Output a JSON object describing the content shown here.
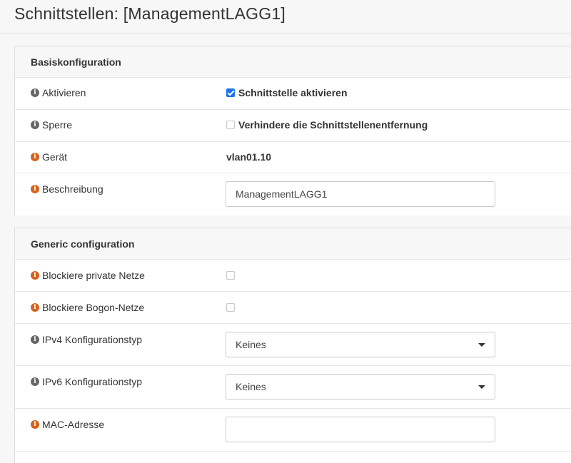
{
  "page": {
    "title": "Schnittstellen: [ManagementLAGG1]"
  },
  "basic": {
    "section_title": "Basiskonfiguration",
    "enable": {
      "label": "Aktivieren",
      "value_label": "Schnittstelle aktivieren",
      "checked": true
    },
    "lock": {
      "label": "Sperre",
      "value_label": "Verhindere die Schnittstellenentfernung",
      "checked": false
    },
    "device": {
      "label": "Gerät",
      "value": "vlan01.10"
    },
    "description": {
      "label": "Beschreibung",
      "value": "ManagementLAGG1"
    }
  },
  "generic": {
    "section_title": "Generic configuration",
    "block_private": {
      "label": "Blockiere private Netze",
      "checked": false
    },
    "block_bogon": {
      "label": "Blockiere Bogon-Netze",
      "checked": false
    },
    "ipv4_type": {
      "label": "IPv4 Konfigurationstyp",
      "selected": "Keines"
    },
    "ipv6_type": {
      "label": "IPv6 Konfigurationstyp",
      "selected": "Keines"
    },
    "mac": {
      "label": "MAC-Adresse",
      "value": ""
    }
  },
  "colors": {
    "info_gray": "#666666",
    "info_orange": "#d6621a",
    "checkbox_checked": "#1a73e8"
  },
  "icons": {
    "info": "info-icon",
    "dropdown": "chevron-down-icon"
  }
}
